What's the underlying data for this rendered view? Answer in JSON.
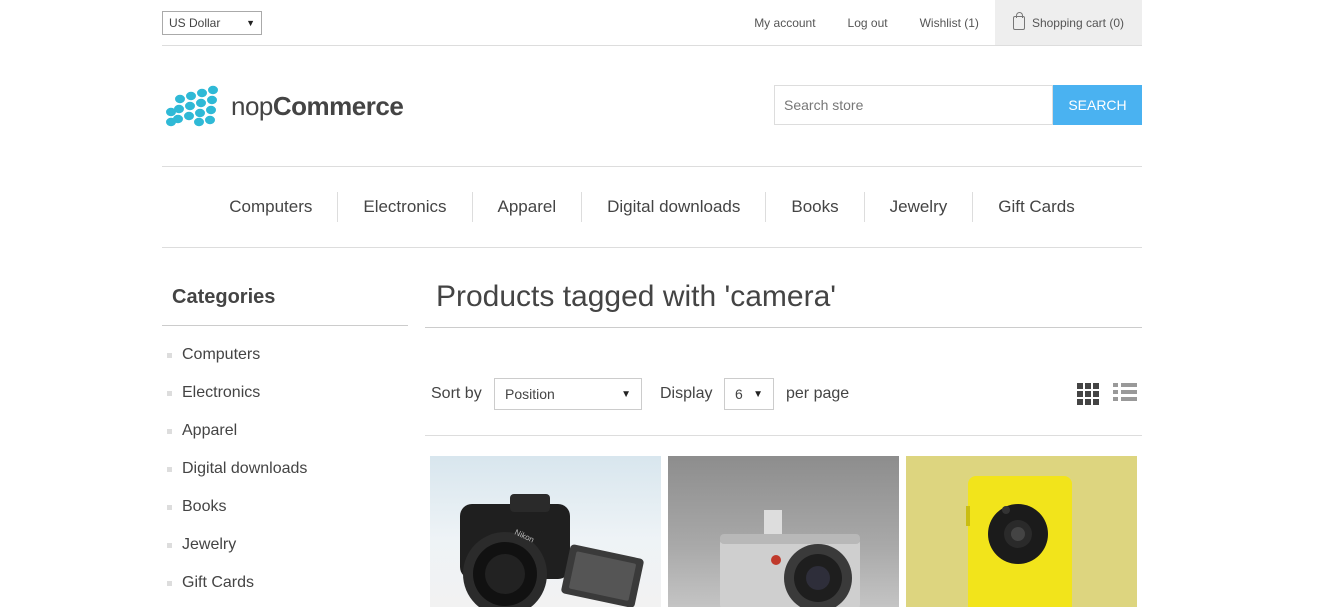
{
  "currency": {
    "selected": "US Dollar"
  },
  "header_links": {
    "my_account": "My account",
    "log_out": "Log out",
    "wishlist": "Wishlist (1)",
    "shopping_cart": "Shopping cart (0)"
  },
  "logo": {
    "text_light": "nop",
    "text_bold": "Commerce",
    "color": "#2fb9d6"
  },
  "search": {
    "placeholder": "Search store",
    "button": "SEARCH",
    "button_color": "#4ab2f1"
  },
  "menu": [
    "Computers",
    "Electronics",
    "Apparel",
    "Digital downloads",
    "Books",
    "Jewelry",
    "Gift Cards"
  ],
  "sidebar": {
    "title": "Categories",
    "items": [
      "Computers",
      "Electronics",
      "Apparel",
      "Digital downloads",
      "Books",
      "Jewelry",
      "Gift Cards"
    ]
  },
  "main": {
    "title": "Products tagged with 'camera'",
    "sort_label": "Sort by",
    "sort_selected": "Position",
    "display_label": "Display",
    "display_selected": "6",
    "per_page_label": "per page"
  },
  "icons": {
    "cart": "shopping-bag-icon",
    "grid_view": "grid-view-icon",
    "list_view": "list-view-icon"
  }
}
